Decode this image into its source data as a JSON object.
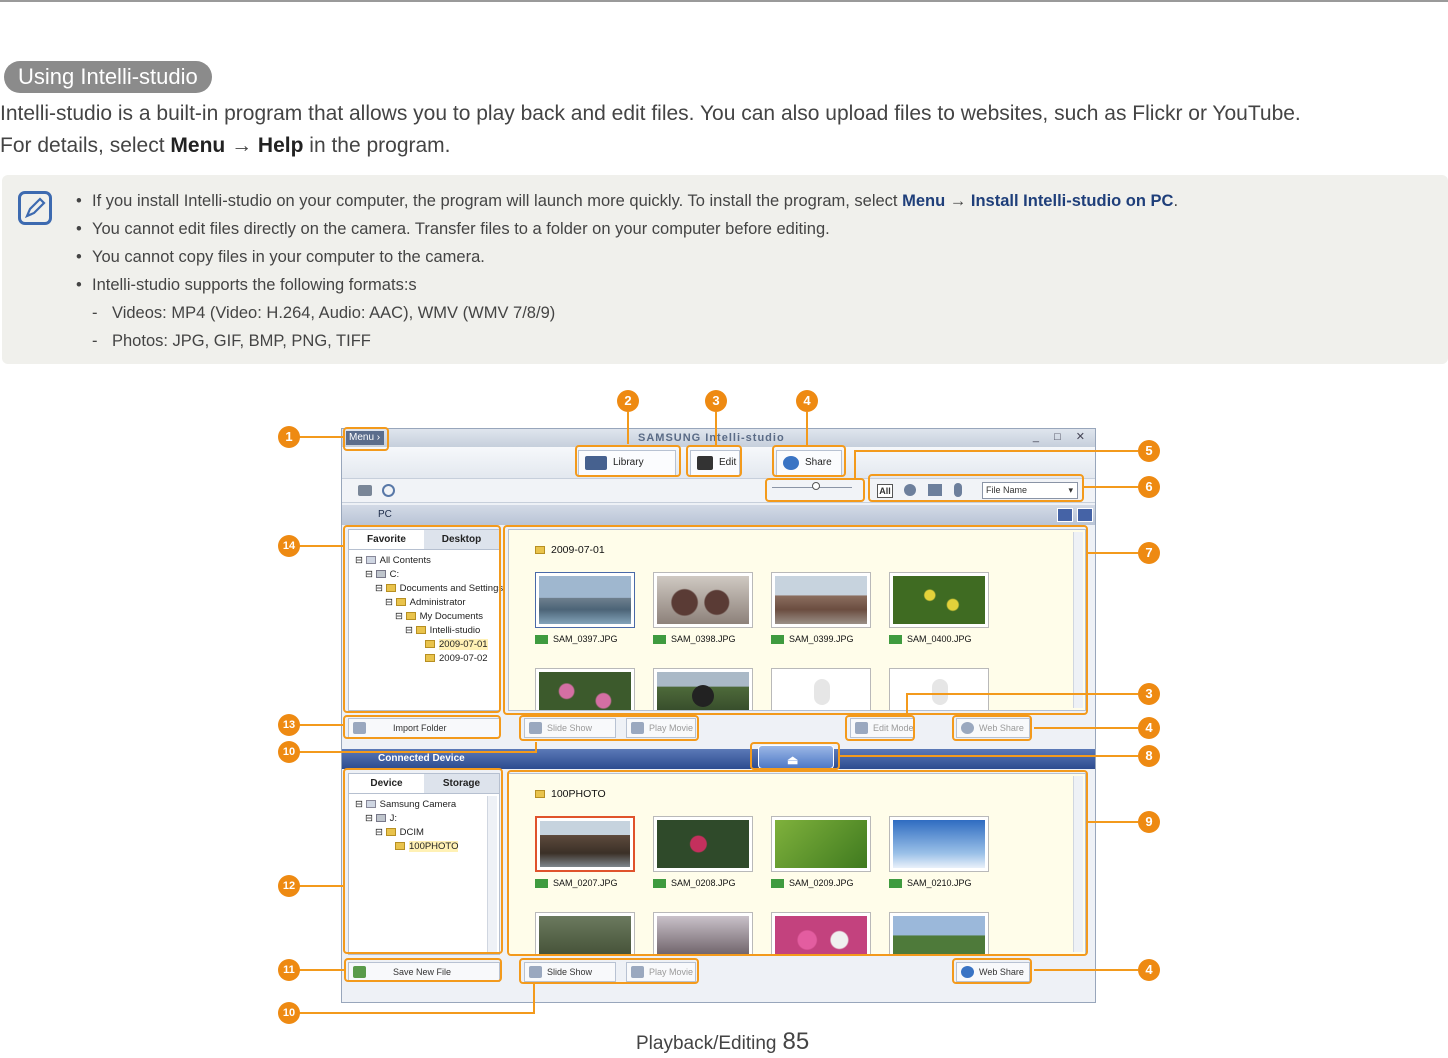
{
  "section_title": "Using Intelli-studio",
  "intro": {
    "line1": "Intelli-studio is a built-in program that allows you to play back and edit files. You can also upload files to websites, such as Flickr or YouTube.",
    "line2_pre": "For details, select ",
    "menu": "Menu",
    "arrow": "→",
    "help": "Help",
    "line2_post": " in the program."
  },
  "notes": {
    "n1_pre": "If you install Intelli-studio on your computer, the program will launch more quickly. To install the program, select ",
    "n1_menu": "Menu",
    "n1_arrow": "→",
    "n1_item": "Install Intelli-studio on PC",
    "n1_post": ".",
    "n2": "You cannot edit files directly on the camera. Transfer files to a folder on your computer before editing.",
    "n3": "You cannot copy files in your computer to the camera.",
    "n4": "Intelli-studio supports the following formats:s",
    "s1": "Videos: MP4 (Video: H.264, Audio: AAC), WMV (WMV 7/8/9)",
    "s2": "Photos: JPG, GIF, BMP, PNG, TIFF"
  },
  "app": {
    "menu_label": "Menu ›",
    "brand": "SAMSUNG Intelli-studio",
    "window_controls": "_ □ ✕",
    "modes": {
      "library": "Library",
      "edit": "Edit",
      "share": "Share"
    },
    "filter_all": "All",
    "sort_option": "File Name",
    "pc_pane": "PC",
    "pc_tabs": [
      "Favorite",
      "Desktop"
    ],
    "pc_tree": [
      "All Contents",
      "C:",
      "Documents and Settings",
      "Administrator",
      "My Documents",
      "Intelli-studio",
      "2009-07-01",
      "2009-07-02"
    ],
    "pc_folder": "2009-07-01",
    "pc_files": [
      "SAM_0397.JPG",
      "SAM_0398.JPG",
      "SAM_0399.JPG",
      "SAM_0400.JPG"
    ],
    "import_folder": "Import Folder",
    "slide_show": "Slide Show",
    "play_movie": "Play Movie",
    "edit_mode": "Edit Mode",
    "web_share": "Web Share",
    "device_pane": "Connected Device",
    "device_tabs": [
      "Device",
      "Storage"
    ],
    "device_tree": [
      "Samsung Camera",
      "J:",
      "DCIM",
      "100PHOTO"
    ],
    "device_folder": "100PHOTO",
    "device_files": [
      "SAM_0207.JPG",
      "SAM_0208.JPG",
      "SAM_0209.JPG",
      "SAM_0210.JPG"
    ],
    "save_new_file": "Save New File"
  },
  "callout_numbers": [
    "1",
    "2",
    "3",
    "4",
    "5",
    "6",
    "7",
    "3",
    "4",
    "8",
    "9",
    "14",
    "13",
    "10",
    "12",
    "11",
    "10",
    "4"
  ],
  "footer": {
    "label": "Playback/Editing",
    "page": "85"
  },
  "colors": {
    "accent": "#ee8a12",
    "note_bg": "#f0f0ec",
    "pill": "#8b8b8b"
  }
}
